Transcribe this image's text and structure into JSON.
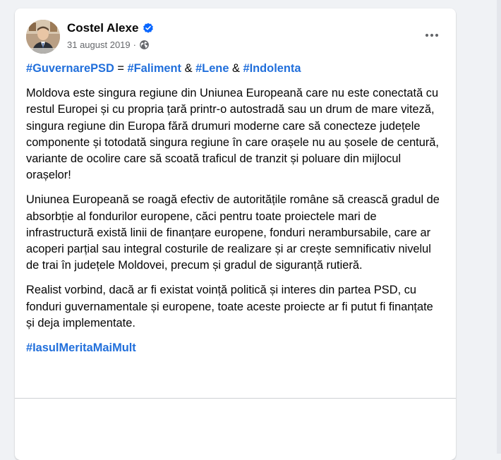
{
  "post": {
    "author": "Costel Alexe",
    "date": "31 august 2019",
    "separator": "·",
    "verified_icon": "verified-badge-icon",
    "privacy_icon": "globe-icon",
    "more_icon": "ellipsis-icon",
    "hashtag_line": {
      "tag1": "#GuvernarePSD",
      "eq": " = ",
      "tag2": "#Faliment",
      "amp1": " & ",
      "tag3": "#Lene",
      "amp2": " & ",
      "tag4": "#Indolenta"
    },
    "paragraphs": [
      "Moldova este singura regiune din Uniunea Europeană care nu este conectată cu restul Europei și cu propria țară printr-o autostradă sau un drum de mare viteză, singura regiune din Europa fără drumuri moderne care să conecteze județele componente și totodată singura regiune în care orașele nu au șosele de centură, variante de ocolire care să scoată traficul de tranzit și poluare din mijlocul orașelor!",
      "Uniunea Europeană se roagă efectiv de autoritățile române să crească gradul de absorbție al fondurilor europene, căci pentru toate proiectele mari de infrastructură există linii de finanțare europene, fonduri nerambursabile, care ar acoperi parțial sau integral costurile de realizare și ar crește semnificativ nivelul de trai în județele Moldovei, precum și gradul de siguranță rutieră.",
      "Realist vorbind, dacă ar fi existat voință politică și interes din partea PSD, cu fonduri guvernamentale și europene, toate aceste proiecte ar fi putut fi finanțate și deja implementate."
    ],
    "closing_hashtag": "#IasulMeritaMaiMult"
  },
  "colors": {
    "hashtag": "#216fdb",
    "verified": "#0866ff",
    "background": "#f0f2f5",
    "text": "#050505",
    "meta": "#65676b"
  }
}
